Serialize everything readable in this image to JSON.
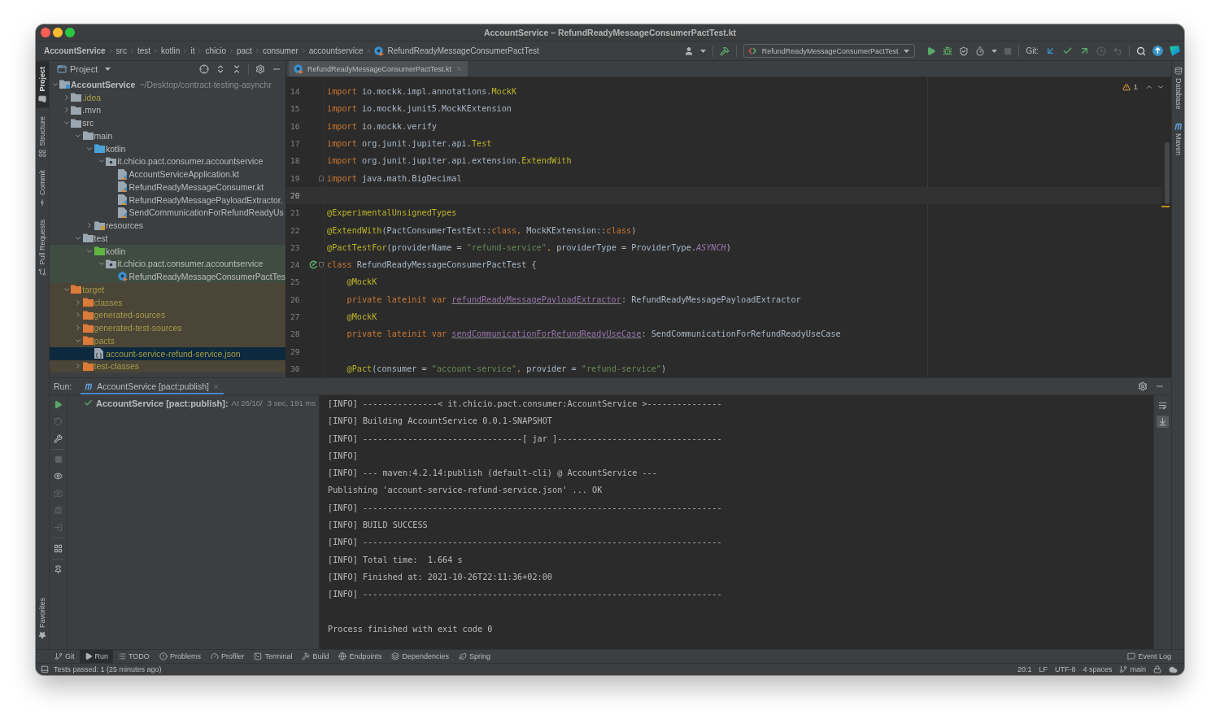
{
  "window": {
    "title": "AccountService – RefundReadyMessageConsumerPactTest.kt"
  },
  "breadcrumbs": [
    {
      "label": "AccountService",
      "kind": "project"
    },
    {
      "label": "src",
      "kind": "dir"
    },
    {
      "label": "test",
      "kind": "dir"
    },
    {
      "label": "kotlin",
      "kind": "dir"
    },
    {
      "label": "it",
      "kind": "dir"
    },
    {
      "label": "chicio",
      "kind": "dir"
    },
    {
      "label": "pact",
      "kind": "dir"
    },
    {
      "label": "consumer",
      "kind": "dir"
    },
    {
      "label": "accountservice",
      "kind": "dir"
    },
    {
      "label": "RefundReadyMessageConsumerPactTest",
      "kind": "class"
    }
  ],
  "toolbar": {
    "run_configuration": "RefundReadyMessageConsumerPactTest",
    "vcs_label": "Git:"
  },
  "left_strip": {
    "top": [
      {
        "label": "Project",
        "kind": "project",
        "selected": true
      },
      {
        "label": "Structure",
        "kind": "structure",
        "selected": false
      },
      {
        "label": "Commit",
        "kind": "commit",
        "selected": false
      },
      {
        "label": "Pull Requests",
        "kind": "pull-requests",
        "selected": false
      }
    ],
    "bottom": [
      {
        "label": "Favorites",
        "kind": "favorites",
        "selected": false
      }
    ]
  },
  "right_strip": [
    {
      "label": "Database",
      "kind": "database",
      "selected": false
    },
    {
      "label": "Maven",
      "kind": "maven",
      "selected": false
    }
  ],
  "project_panel": {
    "title": "Project",
    "tree": [
      {
        "label": "AccountService",
        "hint": "~/Desktop/contract-testing-asynchr",
        "kind": "module",
        "expanded": true,
        "selected": false,
        "ignored": false,
        "children": [
          {
            "label": ".idea",
            "kind": "folder",
            "expanded": false,
            "selected": false,
            "ignored": true
          },
          {
            "label": ".mvn",
            "kind": "folder",
            "expanded": false,
            "selected": false,
            "ignored": false
          },
          {
            "label": "src",
            "kind": "folder",
            "expanded": true,
            "selected": false,
            "ignored": false,
            "children": [
              {
                "label": "main",
                "kind": "folder",
                "expanded": true,
                "selected": false,
                "ignored": false,
                "children": [
                  {
                    "label": "kotlin",
                    "kind": "source-root",
                    "expanded": true,
                    "selected": false,
                    "ignored": false,
                    "children": [
                      {
                        "label": "it.chicio.pact.consumer.accountservice",
                        "kind": "package",
                        "expanded": true,
                        "selected": false,
                        "ignored": false,
                        "children": [
                          {
                            "label": "AccountServiceApplication.kt",
                            "kind": "kotlin-file",
                            "selected": false,
                            "ignored": false
                          },
                          {
                            "label": "RefundReadyMessageConsumer.kt",
                            "kind": "kotlin-file",
                            "selected": false,
                            "ignored": false
                          },
                          {
                            "label": "RefundReadyMessagePayloadExtractor.",
                            "kind": "kotlin-file",
                            "selected": false,
                            "ignored": false
                          },
                          {
                            "label": "SendCommunicationForRefundReadyUs",
                            "kind": "kotlin-file",
                            "selected": false,
                            "ignored": false
                          }
                        ]
                      }
                    ]
                  },
                  {
                    "label": "resources",
                    "kind": "resources-root",
                    "expanded": false,
                    "selected": false,
                    "ignored": false
                  }
                ]
              },
              {
                "label": "test",
                "kind": "folder",
                "expanded": true,
                "selected": false,
                "ignored": false,
                "children": [
                  {
                    "label": "kotlin",
                    "kind": "test-root",
                    "expanded": true,
                    "selected": false,
                    "ignored": false,
                    "children": [
                      {
                        "label": "it.chicio.pact.consumer.accountservice",
                        "kind": "package",
                        "expanded": true,
                        "selected": false,
                        "ignored": false,
                        "children": [
                          {
                            "label": "RefundReadyMessageConsumerPactTes",
                            "kind": "test-class",
                            "selected": false,
                            "ignored": false
                          }
                        ]
                      }
                    ]
                  }
                ]
              }
            ]
          },
          {
            "label": "target",
            "kind": "excluded",
            "expanded": true,
            "selected": false,
            "ignored": true,
            "children": [
              {
                "label": "classes",
                "kind": "excluded",
                "expanded": false,
                "selected": false,
                "ignored": true
              },
              {
                "label": "generated-sources",
                "kind": "excluded",
                "expanded": false,
                "selected": false,
                "ignored": true
              },
              {
                "label": "generated-test-sources",
                "kind": "excluded",
                "expanded": false,
                "selected": false,
                "ignored": true
              },
              {
                "label": "pacts",
                "kind": "excluded",
                "expanded": true,
                "selected": false,
                "ignored": true,
                "children": [
                  {
                    "label": "account-service-refund-service.json",
                    "kind": "json-file",
                    "selected": true,
                    "ignored": true
                  }
                ]
              },
              {
                "label": "test-classes",
                "kind": "excluded",
                "expanded": false,
                "selected": false,
                "ignored": true
              }
            ]
          }
        ]
      }
    ]
  },
  "editor": {
    "tabs": [
      {
        "label": "RefundReadyMessageConsumerPactTest.kt",
        "selected": true
      }
    ],
    "inspections": {
      "warnings": "1"
    },
    "lines": [
      {
        "number": "14",
        "current": false,
        "run_marker": false,
        "indented": false,
        "tokens": [
          {
            "text": "import",
            "kind": "keyword"
          },
          {
            "text": " io.mockk.impl.annotations.",
            "kind": "plain"
          },
          {
            "text": "MockK",
            "kind": "annotation"
          }
        ]
      },
      {
        "number": "15",
        "current": false,
        "run_marker": false,
        "indented": false,
        "tokens": [
          {
            "text": "import",
            "kind": "keyword"
          },
          {
            "text": " io.mockk.junit5.MockKExtension",
            "kind": "plain"
          }
        ]
      },
      {
        "number": "16",
        "current": false,
        "run_marker": false,
        "indented": false,
        "tokens": [
          {
            "text": "import",
            "kind": "keyword"
          },
          {
            "text": " io.mockk.verify",
            "kind": "plain"
          }
        ]
      },
      {
        "number": "17",
        "current": false,
        "run_marker": false,
        "indented": false,
        "tokens": [
          {
            "text": "import",
            "kind": "keyword"
          },
          {
            "text": " org.junit.jupiter.api.",
            "kind": "plain"
          },
          {
            "text": "Test",
            "kind": "annotation"
          }
        ]
      },
      {
        "number": "18",
        "current": false,
        "run_marker": false,
        "indented": false,
        "tokens": [
          {
            "text": "import",
            "kind": "keyword"
          },
          {
            "text": " org.junit.jupiter.api.extension.",
            "kind": "plain"
          },
          {
            "text": "ExtendWith",
            "kind": "annotation"
          }
        ]
      },
      {
        "number": "19",
        "current": false,
        "run_marker": false,
        "indented": false,
        "fold": {
          "kind": "end"
        },
        "tokens": [
          {
            "text": "import",
            "kind": "keyword"
          },
          {
            "text": " java.math.BigDecimal",
            "kind": "plain"
          }
        ]
      },
      {
        "number": "20",
        "current": true,
        "run_marker": false
      },
      {
        "number": "21",
        "current": false,
        "run_marker": false,
        "indented": false,
        "tokens": [
          {
            "text": "@ExperimentalUnsignedTypes",
            "kind": "annotation"
          }
        ]
      },
      {
        "number": "22",
        "current": false,
        "run_marker": false,
        "indented": false,
        "tokens": [
          {
            "text": "@ExtendWith",
            "kind": "annotation"
          },
          {
            "text": "(PactConsumerTestExt::",
            "kind": "plain"
          },
          {
            "text": "class",
            "kind": "keyword"
          },
          {
            "text": ",",
            "kind": "keyword"
          },
          {
            "text": " MockKExtension::",
            "kind": "plain"
          },
          {
            "text": "class",
            "kind": "keyword"
          },
          {
            "text": ")",
            "kind": "plain"
          }
        ]
      },
      {
        "number": "23",
        "current": false,
        "run_marker": false,
        "indented": false,
        "tokens": [
          {
            "text": "@PactTestFor",
            "kind": "annotation"
          },
          {
            "text": "(providerName = ",
            "kind": "plain"
          },
          {
            "text": "\"refund-service\"",
            "kind": "string"
          },
          {
            "text": ",",
            "kind": "keyword"
          },
          {
            "text": " providerType = ProviderType.",
            "kind": "plain"
          },
          {
            "text": "ASYNCH",
            "kind": "constant"
          },
          {
            "text": ")",
            "kind": "plain"
          }
        ]
      },
      {
        "number": "24",
        "current": false,
        "run_marker": true,
        "indented": false,
        "fold": {
          "kind": "start"
        },
        "tokens": [
          {
            "text": "class",
            "kind": "keyword"
          },
          {
            "text": " RefundReadyMessageConsumerPactTest {",
            "kind": "plain"
          }
        ]
      },
      {
        "number": "25",
        "current": false,
        "run_marker": false,
        "indented": true,
        "tokens": [
          {
            "text": "@MockK",
            "kind": "annotation"
          }
        ]
      },
      {
        "number": "26",
        "current": false,
        "run_marker": false,
        "indented": true,
        "tokens": [
          {
            "text": "private lateinit var ",
            "kind": "keyword"
          },
          {
            "text": "refundReadyMessagePayloadExtractor",
            "kind": "field"
          },
          {
            "text": ": RefundReadyMessagePayloadExtractor",
            "kind": "plain"
          }
        ]
      },
      {
        "number": "27",
        "current": false,
        "run_marker": false,
        "indented": true,
        "tokens": [
          {
            "text": "@MockK",
            "kind": "annotation"
          }
        ]
      },
      {
        "number": "28",
        "current": false,
        "run_marker": false,
        "indented": true,
        "tokens": [
          {
            "text": "private lateinit var ",
            "kind": "keyword"
          },
          {
            "text": "sendCommunicationForRefundReadyUseCase",
            "kind": "field"
          },
          {
            "text": ": SendCommunicationForRefundReadyUseCase",
            "kind": "plain"
          }
        ]
      },
      {
        "number": "29",
        "current": false,
        "run_marker": false
      },
      {
        "number": "30",
        "current": false,
        "run_marker": false,
        "indented": true,
        "tokens": [
          {
            "text": "@Pact",
            "kind": "annotation"
          },
          {
            "text": "(consumer = ",
            "kind": "plain"
          },
          {
            "text": "\"account-service\"",
            "kind": "string"
          },
          {
            "text": ",",
            "kind": "keyword"
          },
          {
            "text": " provider = ",
            "kind": "plain"
          },
          {
            "text": "\"refund-service\"",
            "kind": "string"
          },
          {
            "text": ")",
            "kind": "plain"
          }
        ]
      }
    ]
  },
  "run_panel": {
    "title": "Run:",
    "tabs": [
      {
        "label": "AccountService [pact:publish]",
        "selected": true
      }
    ],
    "results": [
      {
        "label": "AccountService [pact:publish]:",
        "detail": "At 26/10/",
        "duration": "3 sec, 191 ms",
        "passed": true
      }
    ],
    "console_options": {
      "soft_wrap": false,
      "scroll_to_end": true
    },
    "console": [
      {
        "text": "[INFO] ---------------< it.chicio.pact.consumer:AccountService >---------------",
        "kind": "log"
      },
      {
        "text": "[INFO] Building AccountService 0.0.1-SNAPSHOT",
        "kind": "log"
      },
      {
        "text": "[INFO] --------------------------------[ jar ]---------------------------------",
        "kind": "log"
      },
      {
        "text": "[INFO]",
        "kind": "log"
      },
      {
        "text": "[INFO] --- maven:4.2.14:publish (default-cli) @ AccountService ---",
        "kind": "log"
      },
      {
        "text": "Publishing 'account-service-refund-service.json' ... OK",
        "kind": "log"
      },
      {
        "text": "[INFO] ------------------------------------------------------------------------",
        "kind": "log"
      },
      {
        "text": "[INFO] BUILD SUCCESS",
        "kind": "log"
      },
      {
        "text": "[INFO] ------------------------------------------------------------------------",
        "kind": "log"
      },
      {
        "text": "[INFO] Total time:  1.664 s",
        "kind": "log"
      },
      {
        "text": "[INFO] Finished at: 2021-10-26T22:11:36+02:00",
        "kind": "log"
      },
      {
        "text": "[INFO] ------------------------------------------------------------------------",
        "kind": "log"
      },
      {
        "text": "Process finished with exit code 0",
        "kind": "exit"
      }
    ]
  },
  "tool_windows": {
    "left": [
      {
        "label": "Git",
        "kind": "git",
        "selected": false
      },
      {
        "label": "Run",
        "kind": "run",
        "selected": true
      },
      {
        "label": "TODO",
        "kind": "todo",
        "selected": false
      },
      {
        "label": "Problems",
        "kind": "problems",
        "selected": false
      },
      {
        "label": "Profiler",
        "kind": "profiler",
        "selected": false
      },
      {
        "label": "Terminal",
        "kind": "terminal",
        "selected": false
      },
      {
        "label": "Build",
        "kind": "build",
        "selected": false
      },
      {
        "label": "Endpoints",
        "kind": "endpoints",
        "selected": false
      },
      {
        "label": "Dependencies",
        "kind": "dependencies",
        "selected": false
      },
      {
        "label": "Spring",
        "kind": "spring",
        "selected": false
      }
    ],
    "right": [
      {
        "label": "Event Log",
        "kind": "event-log",
        "selected": false
      }
    ]
  },
  "status_bar": {
    "message": "Tests passed: 1 (25 minutes ago)",
    "items": [
      "20:1",
      "LF",
      "UTF-8",
      "4 spaces"
    ],
    "branch": "main"
  }
}
